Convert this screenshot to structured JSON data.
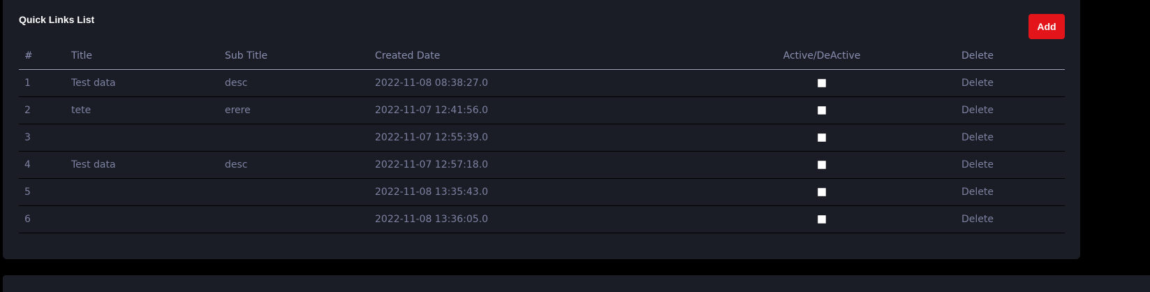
{
  "card": {
    "title": "Quick Links List",
    "add_label": "Add"
  },
  "table": {
    "headers": {
      "num": "#",
      "title": "Title",
      "subtitle": "Sub Title",
      "created": "Created Date",
      "active": "Active/DeActive",
      "delete": "Delete"
    },
    "rows": [
      {
        "num": "1",
        "title": "Test data",
        "subtitle": "desc",
        "created": "2022-11-08 08:38:27.0",
        "active": false,
        "delete": "Delete"
      },
      {
        "num": "2",
        "title": "tete",
        "subtitle": "erere",
        "created": "2022-11-07 12:41:56.0",
        "active": false,
        "delete": "Delete"
      },
      {
        "num": "3",
        "title": "",
        "subtitle": "",
        "created": "2022-11-07 12:55:39.0",
        "active": false,
        "delete": "Delete"
      },
      {
        "num": "4",
        "title": "Test data",
        "subtitle": "desc",
        "created": "2022-11-07 12:57:18.0",
        "active": false,
        "delete": "Delete"
      },
      {
        "num": "5",
        "title": "",
        "subtitle": "",
        "created": "2022-11-08 13:35:43.0",
        "active": false,
        "delete": "Delete"
      },
      {
        "num": "6",
        "title": "",
        "subtitle": "",
        "created": "2022-11-08 13:36:05.0",
        "active": false,
        "delete": "Delete"
      }
    ]
  },
  "colors": {
    "background": "#000000",
    "card": "#1a1d26",
    "accent": "#e4151a",
    "text_muted": "#7d82a1"
  }
}
